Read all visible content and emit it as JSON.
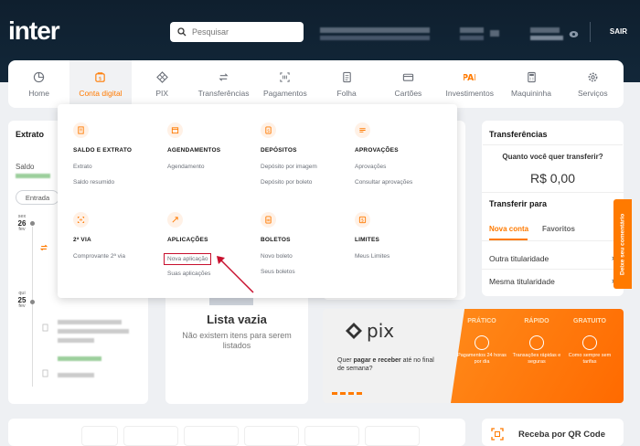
{
  "brand": {
    "logo": "inter",
    "accent": "#ff7a00"
  },
  "header": {
    "search_placeholder": "Pesquisar",
    "logout": "SAIR"
  },
  "nav": [
    {
      "label": "Home",
      "icon": "pie-chart-icon"
    },
    {
      "label": "Conta digital",
      "icon": "wallet-icon",
      "active": true
    },
    {
      "label": "PIX",
      "icon": "pix-icon"
    },
    {
      "label": "Transferências",
      "icon": "transfer-icon"
    },
    {
      "label": "Pagamentos",
      "icon": "barcode-icon"
    },
    {
      "label": "Folha",
      "icon": "document-icon"
    },
    {
      "label": "Cartões",
      "icon": "card-icon"
    },
    {
      "label": "Investimentos",
      "icon": "investment-icon"
    },
    {
      "label": "Maquininha",
      "icon": "calculator-icon"
    },
    {
      "label": "Serviços",
      "icon": "gear-icon"
    }
  ],
  "dropdown": {
    "sections": [
      {
        "title": "SALDO E EXTRATO",
        "links": [
          "Extrato",
          "Saldo resumido"
        ]
      },
      {
        "title": "AGENDAMENTOS",
        "links": [
          "Agendamento"
        ]
      },
      {
        "title": "DEPÓSITOS",
        "links": [
          "Depósito por imagem",
          "Depósito por boleto"
        ]
      },
      {
        "title": "APROVAÇÕES",
        "links": [
          "Aprovações",
          "Consultar aprovações"
        ]
      },
      {
        "title": "2ª VIA",
        "links": [
          "Comprovante 2ª via"
        ]
      },
      {
        "title": "APLICAÇÕES",
        "links": [
          "Nova aplicação",
          "Suas aplicações"
        ]
      },
      {
        "title": "BOLETOS",
        "links": [
          "Novo boleto",
          "Seus boletos"
        ]
      },
      {
        "title": "LIMITES",
        "links": [
          "Meus Limites"
        ]
      }
    ]
  },
  "extrato": {
    "title": "Extrato",
    "saldo_label": "Saldo",
    "filter": "Entrada",
    "dates": [
      {
        "day": "26",
        "wd": "sex",
        "mo": "fev"
      },
      {
        "day": "25",
        "wd": "qui",
        "mo": "fev"
      }
    ]
  },
  "empty": {
    "title": "Lista vazia",
    "text": "Não existem itens para serem listados"
  },
  "transfer": {
    "title": "Transferências",
    "question": "Quanto você quer transferir?",
    "amount": "R$ 0,00",
    "to_title": "Transferir para",
    "tab_new": "Nova conta",
    "tab_fav": "Favoritos",
    "options": [
      "Outra titularidade",
      "Mesma titularidade"
    ]
  },
  "feedback": "Deixe seu comentário",
  "pix_banner": {
    "logo": "pix",
    "text_pre": "Quer ",
    "text_bold": "pagar e receber",
    "text_post": " até no final de semana?",
    "features": [
      {
        "title": "PRÁTICO",
        "desc": "Pagamentos 24 horas por dia"
      },
      {
        "title": "RÁPIDO",
        "desc": "Transações rápidas e seguras"
      },
      {
        "title": "GRATUITO",
        "desc": "Como sempre sem tarifas"
      }
    ]
  },
  "qr": {
    "title": "Receba por QR Code"
  }
}
